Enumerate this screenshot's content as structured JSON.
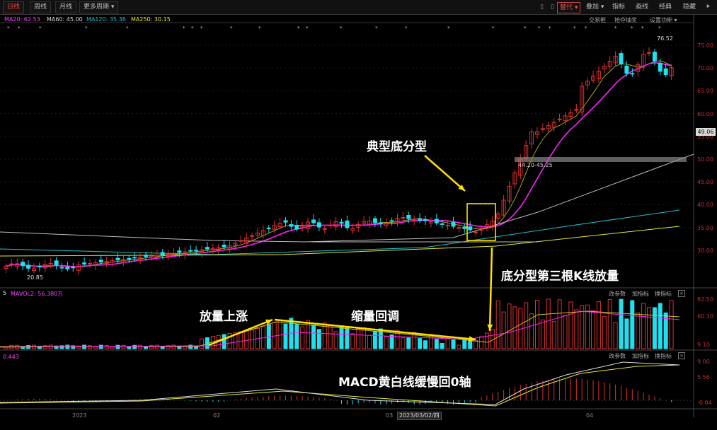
{
  "toolbar": {
    "tabs": [
      "日线",
      "周线",
      "月线",
      "更多周期 ▾"
    ],
    "right": [
      "替代 ▾",
      "叠加 ▾",
      "指标",
      "画线",
      "经典",
      "隐藏"
    ],
    "sub_right": [
      "交易框",
      "抢夺抽奖",
      "设置功能 ▾"
    ]
  },
  "legend_main": {
    "ma20": "MA20: 62.53",
    "ma60": "MA60: 45.00",
    "ma120": "MA120: 35.38",
    "ma250": "MA250: 30.15"
  },
  "legend_vol": {
    "vol": "5",
    "mavol2": "MAVOL2: 56.380万"
  },
  "legend_macd": {
    "val": "0.443"
  },
  "price_axis": [
    "75.00",
    "70.00",
    "65.00",
    "60.00",
    "55.00",
    "50.00",
    "45.00",
    "40.00",
    "35.00",
    "30.00"
  ],
  "price_highlight": "49.06",
  "vol_axis": [
    "82.50",
    "60.10",
    "9.10"
  ],
  "macd_axis": [
    "9.00",
    "5.56",
    "-0.04"
  ],
  "high_price_label": "76.52",
  "low_price_label": "20.85",
  "gap_label": "44.20-45.25",
  "sub_buttons": [
    "改参数",
    "加指标",
    "换指标"
  ],
  "x_labels": [
    "2023",
    "02",
    "03",
    "04"
  ],
  "date_tag": "2023/03/02/四",
  "annotations": {
    "bottom_fractal": "典型底分型",
    "third_k_volume": "底分型第三根K线放量",
    "volume_up": "放量上涨",
    "shrink_pullback": "缩量回调",
    "macd_note": "MACD黄白线缓慢回0轴"
  },
  "colors": {
    "up": "#e03030",
    "down": "#20e0f0",
    "ma_yellow": "#e8e830",
    "ma_magenta": "#ff20ff",
    "ma_gray": "#bbbbbb",
    "ma_cyan": "#20c0d0",
    "box": "#ffe000"
  }
}
